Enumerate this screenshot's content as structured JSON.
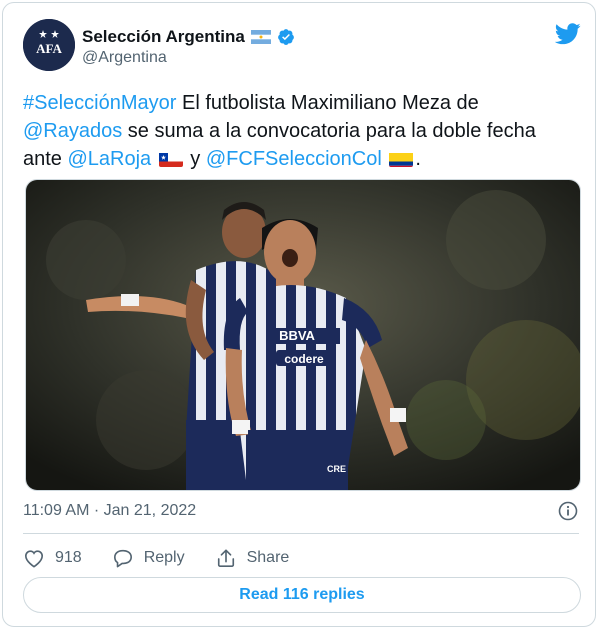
{
  "author": {
    "name": "Selección Argentina",
    "handle": "@Argentina",
    "avatar_text": "AFA"
  },
  "tweet": {
    "parts": {
      "hashtag": "#SelecciónMayor",
      "t1": " El futbolista Maximiliano Meza de ",
      "mention1": "@Rayados",
      "t2": " se suma a la convocatoria para la doble fecha ante ",
      "mention2": "@LaRoja",
      "t3": " y ",
      "mention3": "@FCFSeleccionCol",
      "t4": "."
    }
  },
  "photo": {
    "jersey_sponsor": "BBVA",
    "jersey_sponsor2": "codere",
    "shorts_text": "CRE"
  },
  "meta": {
    "timestamp": "11:09 AM · Jan 21, 2022"
  },
  "actions": {
    "like_count": "918",
    "reply_label": "Reply",
    "share_label": "Share"
  },
  "read_replies_label": "Read 116 replies",
  "colors": {
    "accent": "#1d9bf0",
    "text": "#0f1419",
    "muted": "#536471",
    "border": "#cfd9de",
    "jersey_navy": "#1c2a5a"
  }
}
